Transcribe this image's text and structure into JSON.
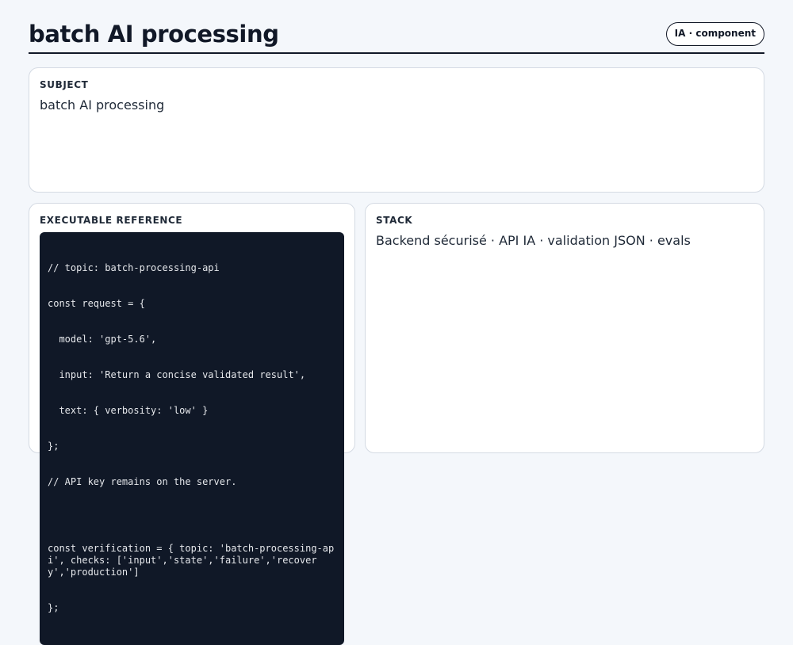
{
  "header": {
    "title": "batch AI processing",
    "badge": "IA · component"
  },
  "subject": {
    "label": "SUBJECT",
    "value": "batch AI processing"
  },
  "code": {
    "label": "EXECUTABLE REFERENCE",
    "lines_part1": [
      "// topic: batch-processing-api",
      "const request = {",
      "  model: 'gpt-5.6',",
      "  input: 'Return a concise validated result',",
      "  text: { verbosity: 'low' }",
      "};",
      "// API key remains on the server."
    ],
    "lines_part2": [
      "const verification = { topic: 'batch-processing-api', checks: ['input','state','failure','recovery','production']",
      "};"
    ]
  },
  "stack": {
    "label": "STACK",
    "value": "Backend sécurisé · API IA · validation JSON · evals"
  }
}
